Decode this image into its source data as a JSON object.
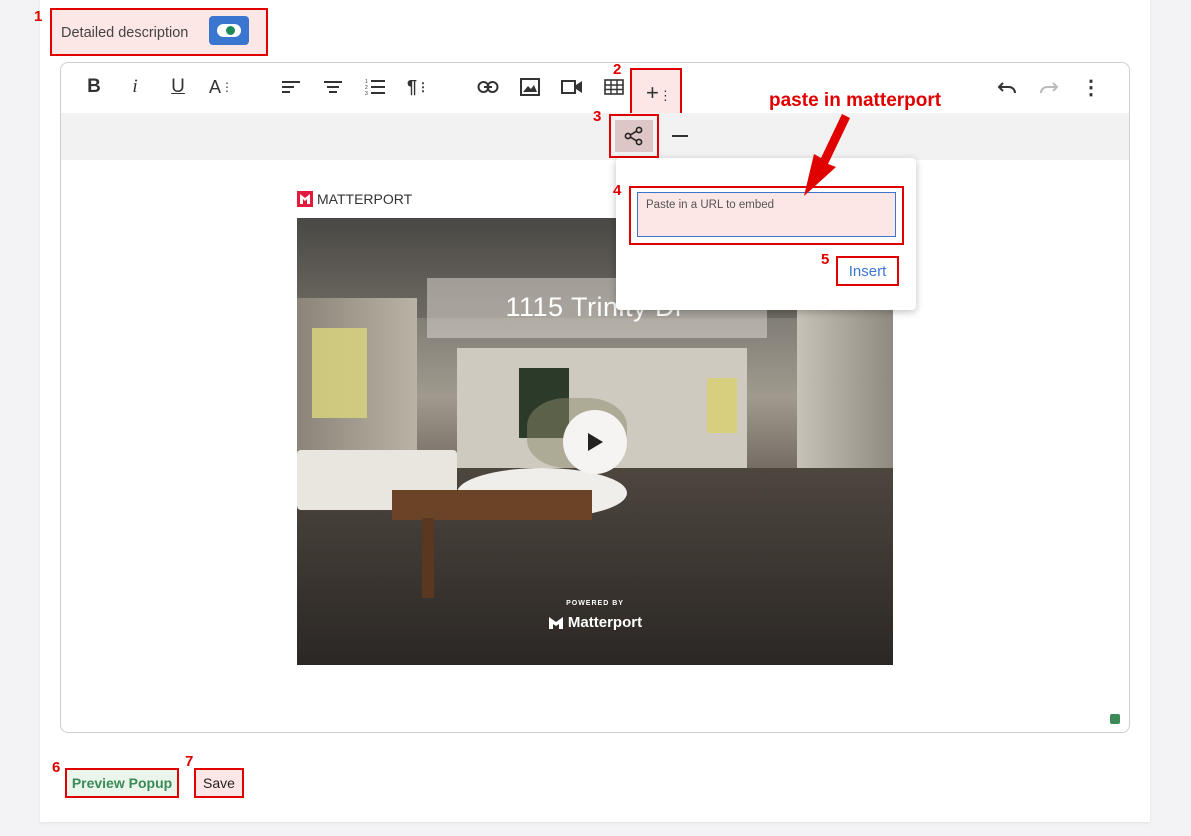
{
  "toggle": {
    "label": "Detailed description",
    "state": "on"
  },
  "toolbar": {
    "bold": "B",
    "italic": "i",
    "underline": "U",
    "font_size": "A",
    "insert_more": "+"
  },
  "callout": "paste in matterport",
  "embed_popup": {
    "placeholder": "Paste in a URL to embed",
    "insert_label": "Insert"
  },
  "matterport": {
    "brand": "MATTERPORT",
    "title": "1115 Trinity Dr",
    "powered_by": "POWERED BY",
    "logo_text": "Matterport"
  },
  "actions": {
    "preview_label": "Preview Popup",
    "save_label": "Save"
  },
  "annotations": [
    "1",
    "2",
    "3",
    "4",
    "5",
    "6",
    "7"
  ],
  "colors": {
    "annotation": "#e00000",
    "accent": "#3a76d0",
    "success": "#3b8a57"
  },
  "icons": [
    "bold-icon",
    "italic-icon",
    "underline-icon",
    "font-size-icon",
    "align-left-icon",
    "align-center-icon",
    "ordered-list-icon",
    "paragraph-icon",
    "link-icon",
    "image-icon",
    "video-icon",
    "table-icon",
    "insert-more-icon",
    "undo-icon",
    "redo-icon",
    "more-icon",
    "share-embed-icon",
    "horizontal-rule-icon",
    "play-icon"
  ]
}
